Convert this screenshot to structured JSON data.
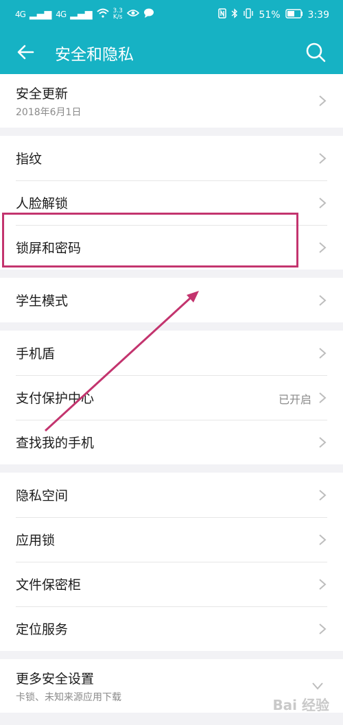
{
  "status_bar": {
    "signal1": "4G",
    "signal2": "4G",
    "speed_value": "3.3",
    "speed_unit": "K/s",
    "battery": "51%",
    "time": "3:39"
  },
  "app_bar": {
    "title": "安全和隐私"
  },
  "groups": [
    {
      "items": [
        {
          "label": "安全更新",
          "sub": "2018年6月1日"
        }
      ]
    },
    {
      "items": [
        {
          "label": "指纹"
        },
        {
          "label": "人脸解锁"
        },
        {
          "label": "锁屏和密码"
        }
      ]
    },
    {
      "items": [
        {
          "label": "学生模式"
        }
      ]
    },
    {
      "items": [
        {
          "label": "手机盾"
        },
        {
          "label": "支付保护中心",
          "value": "已开启"
        },
        {
          "label": "查找我的手机"
        }
      ]
    },
    {
      "items": [
        {
          "label": "隐私空间"
        },
        {
          "label": "应用锁"
        },
        {
          "label": "文件保密柜"
        },
        {
          "label": "定位服务"
        }
      ]
    },
    {
      "items": [
        {
          "label": "更多安全设置",
          "sub": "卡锁、未知来源应用下载"
        }
      ]
    }
  ],
  "watermark": "Bai 经验",
  "colors": {
    "accent": "#16b2c4",
    "annotation": "#c3346e"
  }
}
